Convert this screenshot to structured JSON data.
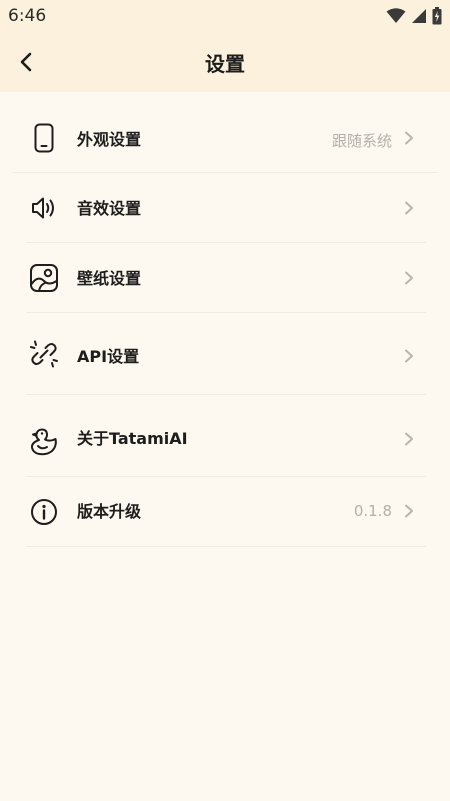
{
  "status_bar": {
    "time": "6:46"
  },
  "app_bar": {
    "title": "设置"
  },
  "colors": {
    "header_bg": "#fcf1dd",
    "page_bg": "#fdf8f0",
    "muted_text": "#b3b0ab"
  },
  "settings": [
    {
      "label": "外观设置",
      "value": "跟随系统",
      "icon": "phone-icon"
    },
    {
      "label": "音效设置",
      "value": "",
      "icon": "speaker-icon"
    },
    {
      "label": "壁纸设置",
      "value": "",
      "icon": "image-icon"
    },
    {
      "label": "API设置",
      "value": "",
      "icon": "broken-link-icon"
    },
    {
      "label": "关于TatamiAI",
      "value": "",
      "icon": "duck-icon"
    },
    {
      "label": "版本升级",
      "value": "0.1.8",
      "icon": "info-icon"
    }
  ]
}
